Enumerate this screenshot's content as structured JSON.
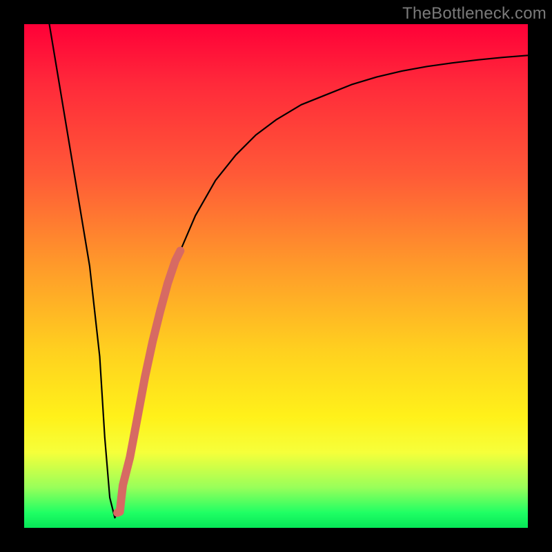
{
  "watermark": "TheBottleneck.com",
  "chart_data": {
    "type": "line",
    "title": "",
    "xlabel": "",
    "ylabel": "",
    "xlim": [
      0,
      100
    ],
    "ylim": [
      0,
      100
    ],
    "grid": false,
    "legend": false,
    "annotations": [],
    "series": [
      {
        "name": "bottleneck-curve",
        "style": "thin-black",
        "x": [
          5,
          7,
          9,
          11,
          13,
          15,
          16,
          17,
          18,
          19,
          21,
          23,
          25,
          28,
          31,
          34,
          38,
          42,
          46,
          50,
          55,
          60,
          65,
          70,
          75,
          80,
          85,
          90,
          95,
          100
        ],
        "y": [
          100,
          88,
          76,
          64,
          52,
          34,
          18,
          6,
          2,
          4,
          14,
          25,
          35,
          46,
          55,
          62,
          69,
          74,
          78,
          81,
          84,
          86,
          88,
          89.5,
          90.7,
          91.6,
          92.3,
          92.9,
          93.4,
          93.8
        ]
      },
      {
        "name": "highlight-segment",
        "style": "thick-salmon",
        "x": [
          18.5,
          19.0,
          19.3,
          19.6,
          21.0,
          22.5,
          24.0,
          25.5,
          27.0,
          28.5,
          30.0,
          31.0
        ],
        "y": [
          3.0,
          3.2,
          6.0,
          8.5,
          14.0,
          22.0,
          30.0,
          37.0,
          43.0,
          48.5,
          53.0,
          55.0
        ]
      }
    ],
    "color_map": "vertical gradient red→yellow→green indicating bottleneck severity (red high, green low)"
  },
  "colors": {
    "curve": "#000000",
    "highlight": "#d76a63",
    "watermark": "#7a7a7a",
    "frame": "#000000"
  }
}
